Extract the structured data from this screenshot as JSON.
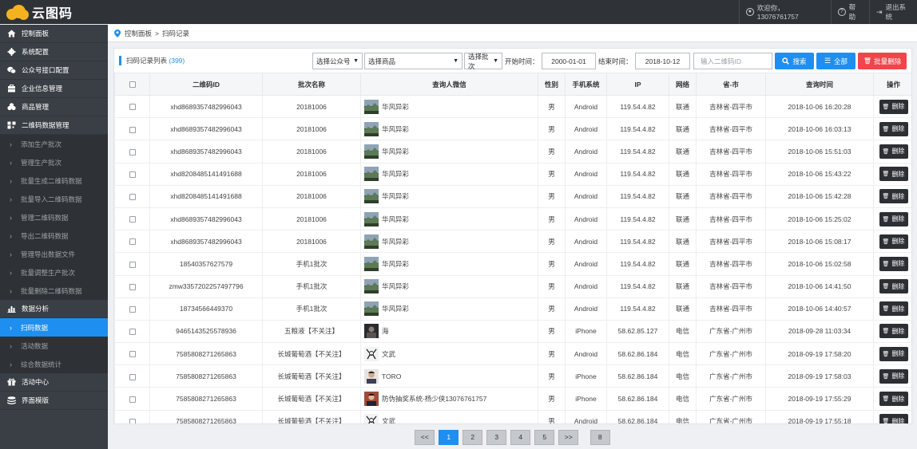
{
  "app": {
    "name": "云图码"
  },
  "topbar": {
    "welcome": "欢迎你，13076761757",
    "help": "帮助",
    "logout": "退出系统"
  },
  "sidebar": {
    "menus": [
      {
        "label": "控制面板",
        "icon": "home-icon"
      },
      {
        "label": "系统配置",
        "icon": "gear-icon"
      },
      {
        "label": "公众号接口配置",
        "icon": "wechat-icon"
      },
      {
        "label": "企业信息管理",
        "icon": "company-icon"
      },
      {
        "label": "商品管理",
        "icon": "products-icon"
      },
      {
        "label": "二维码数据管理",
        "icon": "qrcode-icon"
      }
    ],
    "qr_subs": [
      "添加生产批次",
      "管理生产批次",
      "批量生成二维码数据",
      "批量导入二维码数据",
      "管理二维码数据",
      "导出二维码数据",
      "管理导出数据文件",
      "批量调整生产批次",
      "批量删除二维码数据"
    ],
    "analysis": {
      "label": "数据分析",
      "icon": "bar-chart-icon"
    },
    "analysis_subs": [
      "扫码数据",
      "活动数据",
      "综合数据统计"
    ],
    "activity": {
      "label": "活动中心",
      "icon": "gift-icon"
    },
    "template": {
      "label": "界面模版",
      "icon": "layers-icon"
    }
  },
  "breadcrumb": {
    "home": "控制面板",
    "sep": ">",
    "current": "扫码记录"
  },
  "toolbar": {
    "title": "扫码记录列表",
    "count": "(399)",
    "select_account": "选择公众号",
    "select_product": "选择商品",
    "select_batch": "选择批次",
    "start_label": "开始时间：",
    "start_value": "2000-01-01",
    "end_label": "结束时间：",
    "end_value": "2018-10-12",
    "qr_placeholder": "输入二维码ID",
    "search": "搜索",
    "all": "全部",
    "batch_delete": "批量删除"
  },
  "table": {
    "headers": [
      "二维码ID",
      "批次名称",
      "查询人微信",
      "性别",
      "手机系统",
      "IP",
      "网络",
      "省-市",
      "查询时间",
      "操作"
    ],
    "delete_label": "删除",
    "rows": [
      {
        "id": "xhd8689357482996043",
        "batch": "20181006",
        "wx": "华风异彩",
        "av": "landscape",
        "sex": "男",
        "os": "Android",
        "ip": "119.54.4.82",
        "net": "联通",
        "area": "吉林省-四平市",
        "time": "2018-10-06 16:20:28"
      },
      {
        "id": "xhd8689357482996043",
        "batch": "20181006",
        "wx": "华风异彩",
        "av": "landscape",
        "sex": "男",
        "os": "Android",
        "ip": "119.54.4.82",
        "net": "联通",
        "area": "吉林省-四平市",
        "time": "2018-10-06 16:03:13"
      },
      {
        "id": "xhd8689357482996043",
        "batch": "20181006",
        "wx": "华风异彩",
        "av": "landscape",
        "sex": "男",
        "os": "Android",
        "ip": "119.54.4.82",
        "net": "联通",
        "area": "吉林省-四平市",
        "time": "2018-10-06 15:51:03"
      },
      {
        "id": "xhd8208485141491688",
        "batch": "20181006",
        "wx": "华风异彩",
        "av": "landscape",
        "sex": "男",
        "os": "Android",
        "ip": "119.54.4.82",
        "net": "联通",
        "area": "吉林省-四平市",
        "time": "2018-10-06 15:43:22"
      },
      {
        "id": "xhd8208485141491688",
        "batch": "20181006",
        "wx": "华风异彩",
        "av": "landscape",
        "sex": "男",
        "os": "Android",
        "ip": "119.54.4.82",
        "net": "联通",
        "area": "吉林省-四平市",
        "time": "2018-10-06 15:42:28"
      },
      {
        "id": "xhd8689357482996043",
        "batch": "20181006",
        "wx": "华风异彩",
        "av": "landscape",
        "sex": "男",
        "os": "Android",
        "ip": "119.54.4.82",
        "net": "联通",
        "area": "吉林省-四平市",
        "time": "2018-10-06 15:25:02"
      },
      {
        "id": "xhd8689357482996043",
        "batch": "20181006",
        "wx": "华风异彩",
        "av": "landscape",
        "sex": "男",
        "os": "Android",
        "ip": "119.54.4.82",
        "net": "联通",
        "area": "吉林省-四平市",
        "time": "2018-10-06 15:08:17"
      },
      {
        "id": "18540357627579",
        "batch": "手机1批次",
        "wx": "华风异彩",
        "av": "landscape",
        "sex": "男",
        "os": "Android",
        "ip": "119.54.4.82",
        "net": "联通",
        "area": "吉林省-四平市",
        "time": "2018-10-06 15:02:58"
      },
      {
        "id": "zmw3357202257497796",
        "batch": "手机1批次",
        "wx": "华风异彩",
        "av": "landscape",
        "sex": "男",
        "os": "Android",
        "ip": "119.54.4.82",
        "net": "联通",
        "area": "吉林省-四平市",
        "time": "2018-10-06 14:41:50"
      },
      {
        "id": "18734566449370",
        "batch": "手机1批次",
        "wx": "华风异彩",
        "av": "landscape",
        "sex": "男",
        "os": "Android",
        "ip": "119.54.4.82",
        "net": "联通",
        "area": "吉林省-四平市",
        "time": "2018-10-06 14:40:57"
      },
      {
        "id": "9465143525578936",
        "batch": "五粮液【不关注】",
        "wx": "海",
        "av": "dark",
        "sex": "男",
        "os": "iPhone",
        "ip": "58.62.85.127",
        "net": "电信",
        "area": "广东省-广州市",
        "time": "2018-09-28 11:03:34"
      },
      {
        "id": "7585808271265863",
        "batch": "长城葡萄酒【不关注】",
        "wx": "文武",
        "av": "sketch",
        "sex": "男",
        "os": "Android",
        "ip": "58.62.86.184",
        "net": "电信",
        "area": "广东省-广州市",
        "time": "2018-09-19 17:58:20"
      },
      {
        "id": "7585808271265863",
        "batch": "长城葡萄酒【不关注】",
        "wx": "TORO",
        "av": "person",
        "sex": "男",
        "os": "iPhone",
        "ip": "58.62.86.184",
        "net": "电信",
        "area": "广东省-广州市",
        "time": "2018-09-19 17:58:03"
      },
      {
        "id": "7585808271265863",
        "batch": "长城葡萄酒【不关注】",
        "wx": "防伪抽奖系统-杨少侠13076761757",
        "av": "person2",
        "sex": "男",
        "os": "iPhone",
        "ip": "58.62.86.184",
        "net": "电信",
        "area": "广东省-广州市",
        "time": "2018-09-19 17:55:29"
      },
      {
        "id": "7585808271265863",
        "batch": "长城葡萄酒【不关注】",
        "wx": "文武",
        "av": "sketch",
        "sex": "男",
        "os": "Android",
        "ip": "58.62.86.184",
        "net": "电信",
        "area": "广东省-广州市",
        "time": "2018-09-19 17:55:18"
      }
    ]
  },
  "pager": {
    "items": [
      "<<",
      "1",
      "2",
      "3",
      "4",
      "5",
      ">>",
      "8"
    ],
    "current": "1"
  },
  "colors": {
    "accent": "#1e8ff0",
    "danger": "#f0454a",
    "sidebar": "#3a3f45",
    "topbar": "#2f3338"
  }
}
